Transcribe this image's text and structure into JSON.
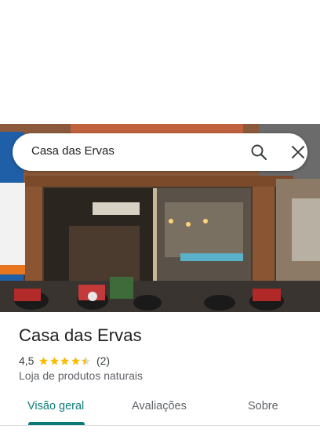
{
  "search": {
    "query": "Casa das Ervas"
  },
  "place": {
    "name": "Casa das Ervas",
    "rating": "4,5",
    "rating_value": 4.5,
    "review_count": "(2)",
    "category": "Loja de produtos naturais"
  },
  "tabs": [
    {
      "label": "Visão geral",
      "active": true
    },
    {
      "label": "Avaliações",
      "active": false
    },
    {
      "label": "Sobre",
      "active": false
    }
  ],
  "colors": {
    "accent": "#0b7a75",
    "star": "#fbbc04",
    "text": "#202124",
    "secondary_text": "#5f6368"
  },
  "icons": {
    "search": "search-icon",
    "close": "close-icon",
    "star": "star-icon"
  }
}
